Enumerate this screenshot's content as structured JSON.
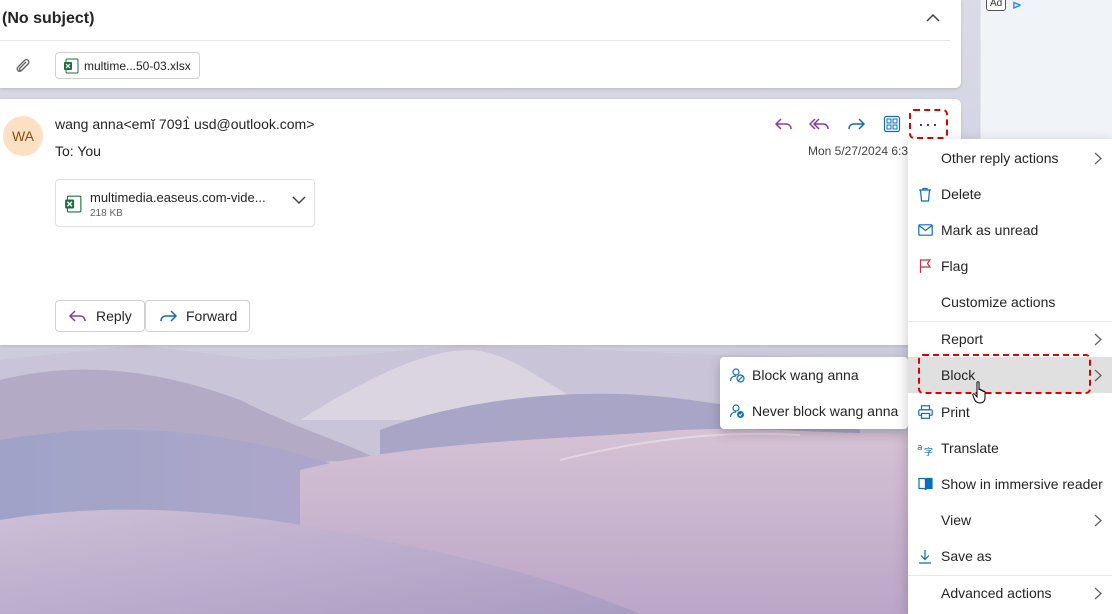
{
  "subject": {
    "title": "(No subject)"
  },
  "attachment_chip": {
    "label": "multime...50-03.xlsx"
  },
  "message": {
    "avatar_initials": "WA",
    "sender": "wang anna<emĭ 7091̀ usd@outlook.com>",
    "to_label": "To:",
    "to_value": "You",
    "date": "Mon 5/27/2024 6:3"
  },
  "file_attachment": {
    "name": "multimedia.easeus.com-vide...",
    "size": "218 KB"
  },
  "buttons": {
    "reply": "Reply",
    "forward": "Forward",
    "more": "···"
  },
  "context_menu": {
    "items": [
      {
        "label": "Other reply actions",
        "icon": "none",
        "submenu": true
      },
      {
        "label": "Delete",
        "icon": "trash-icon",
        "submenu": false
      },
      {
        "label": "Mark as unread",
        "icon": "envelope-icon",
        "submenu": false
      },
      {
        "label": "Flag",
        "icon": "flag-icon",
        "submenu": false
      },
      {
        "label": "Customize actions",
        "icon": "none",
        "submenu": false
      },
      {
        "label": "Report",
        "icon": "none",
        "submenu": true
      },
      {
        "label": "Block",
        "icon": "none",
        "submenu": true,
        "highlighted": true
      },
      {
        "label": "Print",
        "icon": "printer-icon",
        "submenu": false
      },
      {
        "label": "Translate",
        "icon": "translate-icon",
        "submenu": false
      },
      {
        "label": "Show in immersive reader",
        "icon": "reader-icon",
        "submenu": false
      },
      {
        "label": "View",
        "icon": "none",
        "submenu": true
      },
      {
        "label": "Save as",
        "icon": "download-icon",
        "submenu": false
      },
      {
        "label": "Advanced actions",
        "icon": "none",
        "submenu": true
      }
    ]
  },
  "block_submenu": {
    "items": [
      {
        "label": "Block wang anna",
        "icon": "block-person-icon"
      },
      {
        "label": "Never block wang anna",
        "icon": "allow-person-icon"
      }
    ]
  },
  "ad": {
    "badge": "Ad",
    "choices_glyph": "⊳"
  },
  "colors": {
    "accent_purple": "#8a3aa8",
    "accent_blue": "#0f6cbd",
    "highlight_red": "#e00000",
    "excel_green": "#1d6f42"
  }
}
